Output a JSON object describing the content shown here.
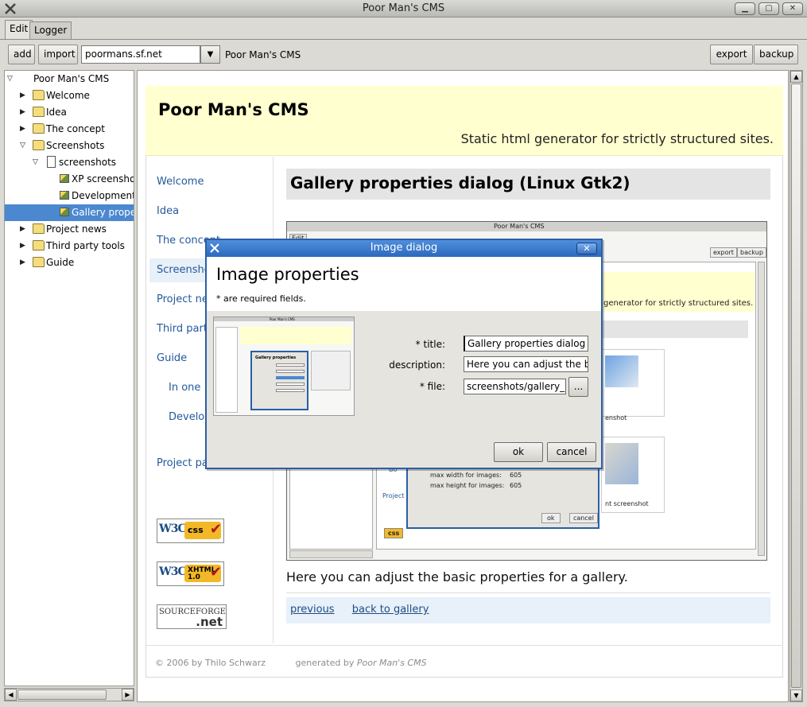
{
  "window": {
    "title": "Poor Man's CMS",
    "btn_min": "▁",
    "btn_max": "▢",
    "btn_close": "✕"
  },
  "tabs": [
    {
      "label": "Edit",
      "active": true
    },
    {
      "label": "Logger",
      "active": false
    }
  ],
  "toolbar": {
    "add_label": "add",
    "import_label": "import",
    "site_combo_value": "poormans.sf.net",
    "site_name": "Poor Man's CMS",
    "export_label": "export",
    "backup_label": "backup"
  },
  "tree": {
    "root": "Poor Man's CMS",
    "items": [
      {
        "label": "Welcome"
      },
      {
        "label": "Idea"
      },
      {
        "label": "The concept"
      },
      {
        "label": "Screenshots"
      },
      {
        "label": "screenshots"
      },
      {
        "label": "XP screenshot"
      },
      {
        "label": "Development"
      },
      {
        "label": "Gallery properties dialog"
      },
      {
        "label": "Project news"
      },
      {
        "label": "Third party tools"
      },
      {
        "label": "Guide"
      }
    ]
  },
  "site": {
    "title": "Poor Man's CMS",
    "subtitle": "Static html generator for strictly structured sites.",
    "nav": [
      "Welcome",
      "Idea",
      "The concept",
      "Screenshots",
      "Project news",
      "Third party tools",
      "Guide",
      "In one",
      "Develop",
      "Project page"
    ],
    "badges": {
      "css_w3": "W3C",
      "css_label": "css",
      "xhtml_w3": "W3C",
      "xhtml_label": "XHTML 1.0",
      "sf_top": "SOURCEFORGE",
      "sf_bottom": ".net",
      "check": "✔"
    },
    "page_heading": "Gallery properties dialog (Linux Gtk2)",
    "caption": "Here you can adjust the basic properties for a gallery.",
    "pager": {
      "previous": "previous",
      "back": "back to gallery"
    },
    "footer_copy": "© 2006 by Thilo Schwarz",
    "footer_gen": "generated by",
    "footer_gen_name": "Poor Man's CMS"
  },
  "inner_shot": {
    "title": "Poor Man's CMS",
    "edit_tab": "Edit",
    "export": "export",
    "backup": "backup",
    "subtitle": "generator for strictly structured sites.",
    "shot_label1": "enshot",
    "shot_label2": "nt screenshot",
    "max_width_label": "max width for images:",
    "max_width_value": "605",
    "max_height_label": "max height for images:",
    "max_height_value": "605",
    "ok": "ok",
    "cancel": "cancel",
    "nav_b": "Bo",
    "nav_project": "Project",
    "css_badge": "css"
  },
  "dialog": {
    "title": "Image dialog",
    "close": "✕",
    "heading": "Image properties",
    "required_note": "* are required fields.",
    "fields": {
      "title_label": "*   title:",
      "title_value": "Gallery properties dialog (L",
      "description_label": "description:",
      "description_value": "Here you can adjust the ba",
      "file_label": "*   file:",
      "file_value": "screenshots/gallery_p",
      "browse": "..."
    },
    "ok": "ok",
    "cancel": "cancel",
    "thumb_title": "Poor Man's CMS",
    "thumb_dialog_title": "Gallery properties"
  }
}
